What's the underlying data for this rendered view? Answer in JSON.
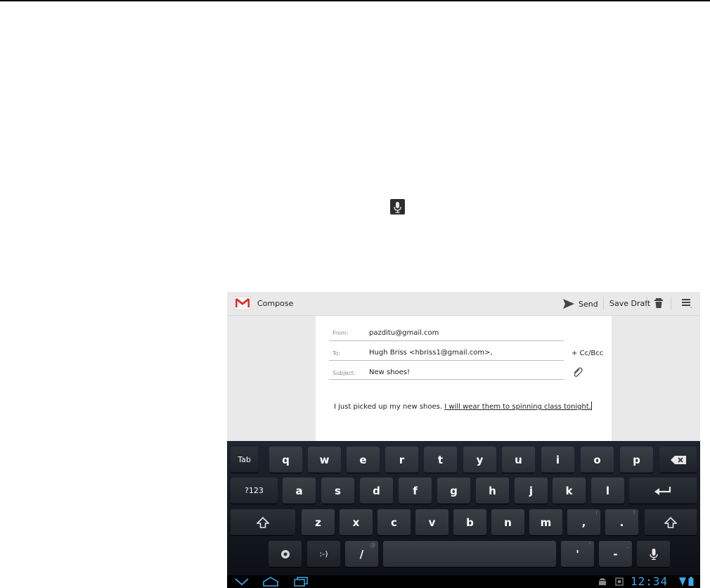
{
  "compose": {
    "title": "Compose",
    "send_label": "Send",
    "save_draft_label": "Save Draft",
    "from_label": "From:",
    "from_value": "pazditu@gmail.com",
    "to_label": "To:",
    "to_value": "Hugh Briss <hbriss1@gmail.com>,",
    "ccbcc_label": "+ Cc/Bcc",
    "subject_label": "Subject:",
    "subject_value": "New shoes!",
    "body_typed": "I just picked up my new shoes. ",
    "body_suggestion": "I will wear them to spinning class tonight."
  },
  "keyboard": {
    "row1": [
      "Tab",
      "q",
      "w",
      "e",
      "r",
      "t",
      "y",
      "u",
      "i",
      "o",
      "p"
    ],
    "row2": [
      "?123",
      "a",
      "s",
      "d",
      "f",
      "g",
      "h",
      "j",
      "k",
      "l"
    ],
    "row3": [
      "z",
      "x",
      "c",
      "v",
      "b",
      "n",
      "m",
      ",",
      "."
    ],
    "row3_hints": {
      "comma": "!",
      "period": "?"
    },
    "row4": {
      "emoticon": ":-)",
      "slash": "/",
      "apostrophe": "'",
      "dash": "-"
    }
  },
  "status": {
    "clock": "12:34"
  },
  "icons": {
    "floating": "microphone-icon",
    "logo": "gmail-logo-icon",
    "send": "send-icon",
    "trash": "trash-icon",
    "menu": "menu-icon",
    "attach": "paperclip-icon",
    "backspace": "backspace-icon",
    "enter": "enter-icon",
    "shift": "shift-icon",
    "settings": "keyboard-settings-icon",
    "voice": "microphone-icon",
    "back": "back-icon",
    "home": "home-icon",
    "recents": "recent-apps-icon",
    "android": "android-icon",
    "sdcard": "storage-icon",
    "wifi": "wifi-icon",
    "battery": "battery-icon"
  },
  "colors": {
    "clock": "#3fa6e8",
    "gmail_red": "#d9302b",
    "keyboard_bg": "#14181f"
  }
}
